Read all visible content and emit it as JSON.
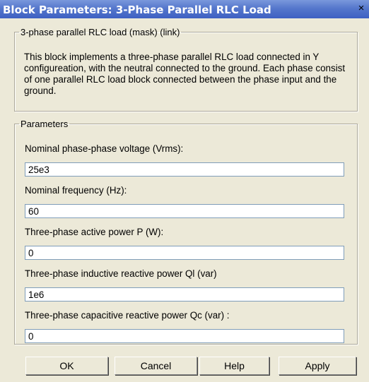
{
  "window": {
    "title": "Block Parameters: 3-Phase Parallel RLC Load",
    "close_glyph": "×"
  },
  "description": {
    "legend": "3-phase parallel RLC load  (mask) (link)",
    "text": "This block implements a three-phase parallel RLC load connected in Y configureation, with the neutral connected to the ground. Each phase consist of one parallel RLC load block connected between the phase input and the ground."
  },
  "parameters": {
    "legend": "Parameters",
    "fields": [
      {
        "label": "Nominal phase-phase voltage (Vrms):",
        "value": "25e3"
      },
      {
        "label": "Nominal frequency (Hz):",
        "value": "60"
      },
      {
        "label": "Three-phase active power P (W):",
        "value": "0"
      },
      {
        "label": "Three-phase inductive reactive power Ql (var)",
        "value": "1e6"
      },
      {
        "label": "Three-phase capacitive reactive power Qc (var) :",
        "value": "0"
      }
    ]
  },
  "buttons": {
    "ok": "OK",
    "cancel": "Cancel",
    "help": "Help",
    "apply": "Apply"
  }
}
